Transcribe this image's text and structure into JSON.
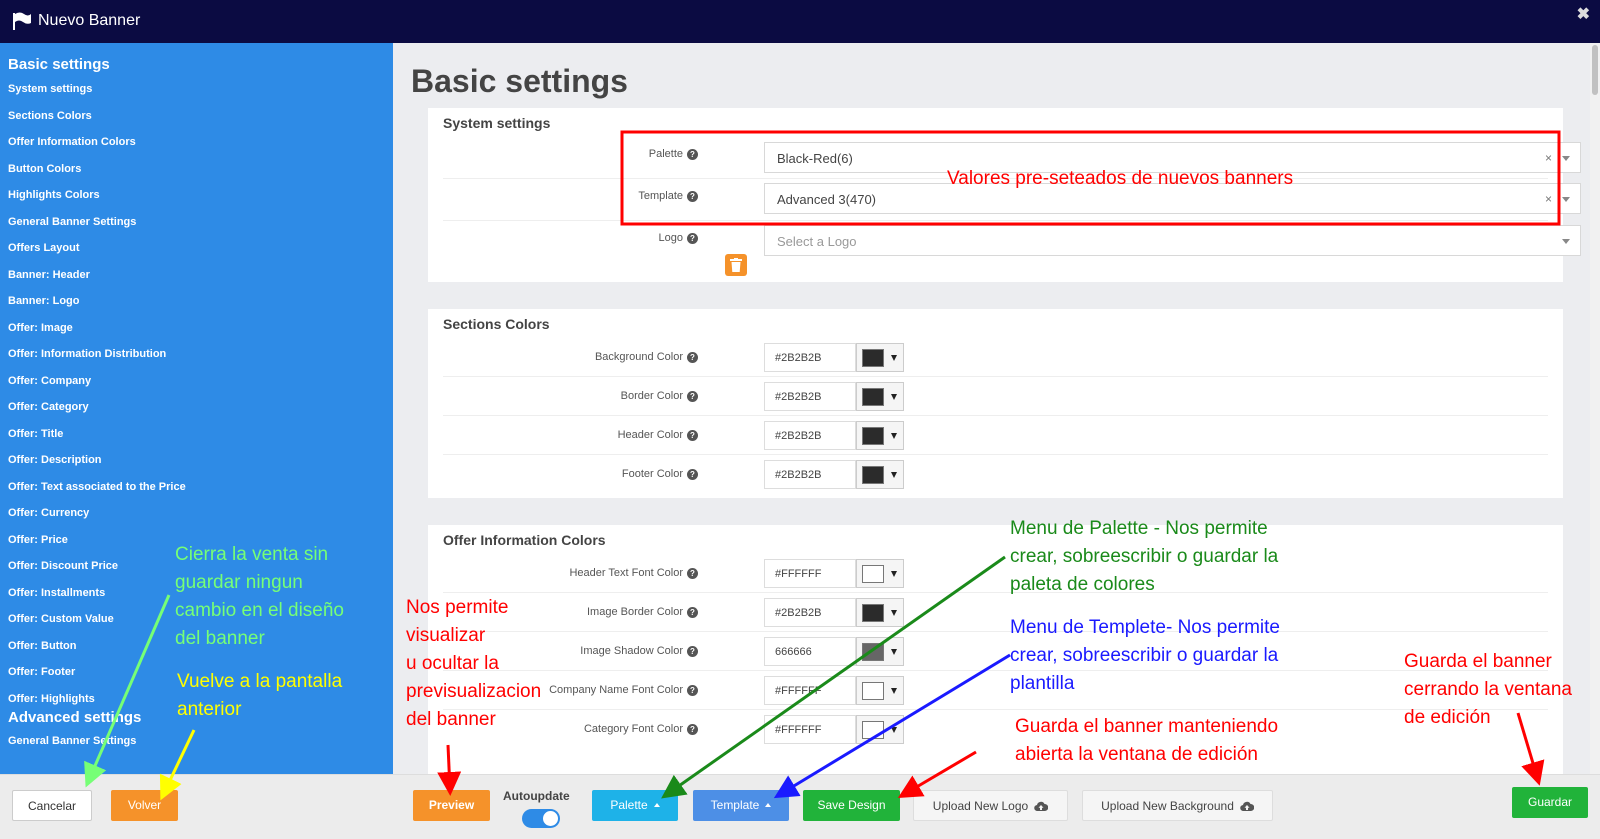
{
  "window": {
    "title": "Nuevo Banner",
    "close": "✖"
  },
  "sidebar": {
    "basic_heading": "Basic settings",
    "items": [
      "System settings",
      "Sections Colors",
      "Offer Information Colors",
      "Button Colors",
      "Highlights Colors",
      "General Banner Settings",
      "Offers Layout",
      "Banner: Header",
      "Banner: Logo",
      "Offer: Image",
      "Offer: Information Distribution",
      "Offer: Company",
      "Offer: Category",
      "Offer: Title",
      "Offer: Description",
      "Offer: Text associated to the Price",
      "Offer: Currency",
      "Offer: Price",
      "Offer: Discount Price",
      "Offer: Installments",
      "Offer: Custom Value",
      "Offer: Button",
      "Offer: Footer",
      "Offer: Highlights"
    ],
    "advanced_heading": "Advanced settings",
    "advanced_items": [
      "General Banner Settings"
    ]
  },
  "main": {
    "heading": "Basic settings",
    "system": {
      "title": "System settings",
      "palette_label": "Palette",
      "palette_value": "Black-Red(6)",
      "template_label": "Template",
      "template_value": "Advanced 3(470)",
      "logo_label": "Logo",
      "logo_placeholder": "Select a Logo",
      "clear": "×"
    },
    "sections_colors": {
      "title": "Sections Colors",
      "rows": [
        {
          "label": "Background Color",
          "value": "#2B2B2B",
          "swatch": "#2b2b2b"
        },
        {
          "label": "Border Color",
          "value": "#2B2B2B",
          "swatch": "#2b2b2b"
        },
        {
          "label": "Header Color",
          "value": "#2B2B2B",
          "swatch": "#2b2b2b"
        },
        {
          "label": "Footer Color",
          "value": "#2B2B2B",
          "swatch": "#2b2b2b"
        }
      ]
    },
    "offer_info_colors": {
      "title": "Offer Information Colors",
      "rows": [
        {
          "label": "Header Text Font Color",
          "value": "#FFFFFF",
          "swatch": "#ffffff"
        },
        {
          "label": "Image Border Color",
          "value": "#2B2B2B",
          "swatch": "#2b2b2b"
        },
        {
          "label": "Image Shadow Color",
          "value": "666666",
          "swatch": "#666666"
        },
        {
          "label": "Company Name Font Color",
          "value": "#FFFFFF",
          "swatch": "#ffffff"
        },
        {
          "label": "Category Font Color",
          "value": "#FFFFFF",
          "swatch": "#ffffff"
        }
      ]
    }
  },
  "footer": {
    "cancel": "Cancelar",
    "back": "Volver",
    "preview": "Preview",
    "autoupdate": "Autoupdate",
    "palette": "Palette",
    "template": "Template",
    "save_design": "Save Design",
    "upload_logo": "Upload New Logo",
    "upload_background": "Upload New Background",
    "save": "Guardar"
  },
  "annotations": {
    "preset": "Valores pre-seteados de nuevos banners",
    "palette_menu": [
      "Menu de Palette - Nos permite",
      "crear, sobreescribir o guardar la",
      "paleta de colores"
    ],
    "template_menu": [
      "Menu de Templete- Nos permite",
      "crear, sobreescribir o guardar la",
      "plantilla"
    ],
    "preview_note": [
      "Nos permite",
      "visualizar",
      "u ocultar la",
      "previsualizacion",
      "del banner"
    ],
    "cancel_note": [
      "Cierra la venta sin",
      "guardar ningun",
      "cambio en el diseño",
      "del banner"
    ],
    "back_note": [
      "Vuelve a la pantalla",
      "anterior"
    ],
    "save_design_note": [
      "Guarda el banner manteniendo",
      "abierta la ventana de edición"
    ],
    "save_note": [
      "Guarda el banner",
      "cerrando la ventana",
      "de edición"
    ]
  },
  "colors": {
    "titlebar": "#0b0b42",
    "sidebar": "#2e8be6",
    "orange": "#f5922a",
    "cyan": "#1eb2e8",
    "blue_btn": "#4d8fe6",
    "green_btn": "#21b33a",
    "red_annot": "#ff0000",
    "green_annot": "#1a8a1a",
    "blue_annot": "#1a1aff",
    "lime_annot": "#76ff76",
    "yellow_annot": "#ffff00"
  }
}
